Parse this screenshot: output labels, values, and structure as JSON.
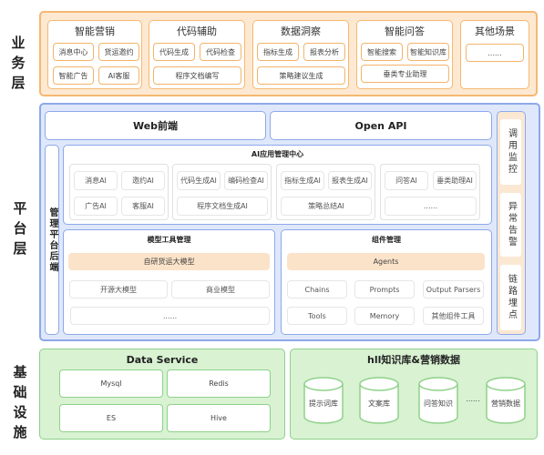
{
  "layers": {
    "business": "业务层",
    "platform": "平台层",
    "infrastructure": "基础设施"
  },
  "business": {
    "groups": [
      {
        "title": "智能营销",
        "items": [
          "消息中心",
          "货运邀约",
          "智能广告",
          "AI客服"
        ]
      },
      {
        "title": "代码辅助",
        "items": [
          "代码生成",
          "代码检查",
          "程序文档编写"
        ]
      },
      {
        "title": "数据洞察",
        "items": [
          "指标生成",
          "报表分析",
          "策略建议生成"
        ]
      },
      {
        "title": "智能问答",
        "items": [
          "智能搜索",
          "智能知识库",
          "垂类专业助理"
        ]
      },
      {
        "title": "其他场景",
        "items": [
          "......"
        ]
      }
    ]
  },
  "platform": {
    "web_frontend": "Web前端",
    "open_api": "Open API",
    "mgmt_backend": "管理平台后端",
    "ai_app_center": {
      "title": "AI应用管理中心",
      "groups": [
        {
          "items": [
            "消息AI",
            "邀约AI",
            "广告AI",
            "客服AI"
          ]
        },
        {
          "items": [
            "代码生成AI",
            "编码检查AI",
            "程序文档生成AI"
          ]
        },
        {
          "items": [
            "指标生成AI",
            "报表生成AI",
            "策略总结AI"
          ]
        },
        {
          "items": [
            "问答AI",
            "垂类助理AI",
            "......"
          ]
        }
      ]
    },
    "model_tools": {
      "title": "模型工具管理",
      "highlight": "自研货运大模型",
      "items": [
        "开源大模型",
        "商业模型",
        "......"
      ]
    },
    "components": {
      "title": "组件管理",
      "highlight": "Agents",
      "items": [
        "Chains",
        "Prompts",
        "Output Parsers",
        "Tools",
        "Memory",
        "其他组件工具"
      ]
    },
    "monitoring": [
      "调用监控",
      "异常告警",
      "链路埋点"
    ]
  },
  "infrastructure": {
    "data_service": {
      "title": "Data Service",
      "items": [
        "Mysql",
        "Redis",
        "ES",
        "Hive"
      ]
    },
    "knowledge": {
      "title": "hll知识库&营销数据",
      "items": [
        "提示词库",
        "文案库",
        "问答知识",
        "营销数据"
      ],
      "ellipsis": "......"
    }
  },
  "colors": {
    "business_fill": "#fde9d2",
    "business_border": "#f5b872",
    "platform_fill": "#dfe8fb",
    "platform_border": "#8da8ea",
    "infra_fill": "#d8f2d2",
    "infra_border": "#8fd18a",
    "highlight_fill": "#fbe3c9"
  }
}
